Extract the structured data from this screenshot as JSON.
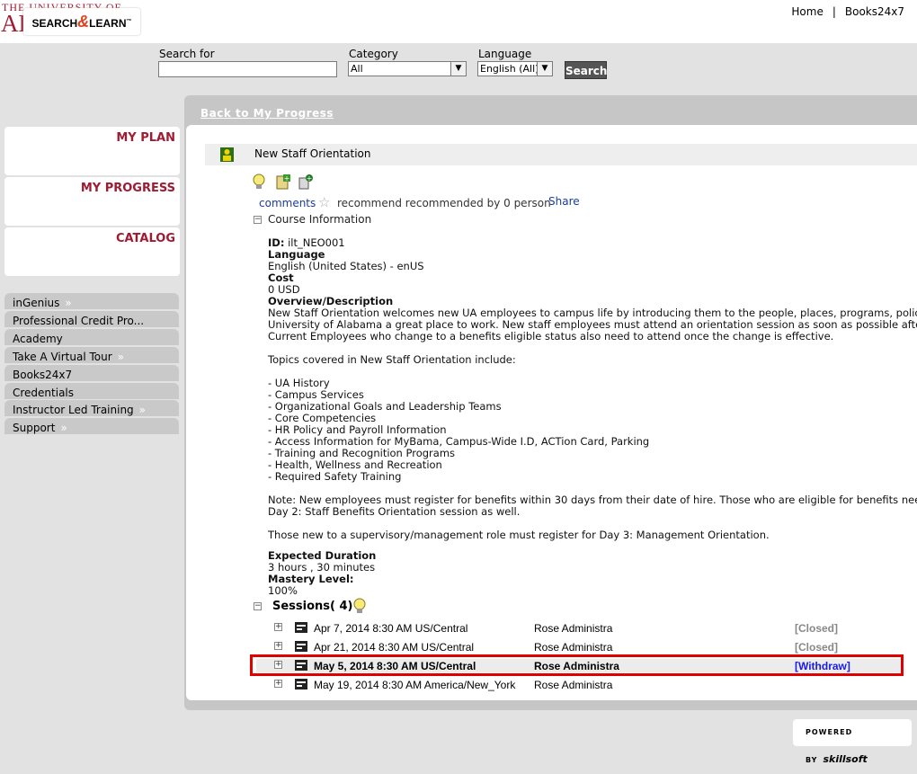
{
  "header": {
    "university_small": "THE UNIVERSITY OF",
    "university_big": "ALABAMA",
    "links": [
      "Home",
      "Books24x7"
    ]
  },
  "search": {
    "logo_left": "SEARCH",
    "logo_amp": "&",
    "logo_right": "LEARN",
    "search_label": "Search for",
    "search_value": "",
    "category_label": "Category",
    "category_value": "All",
    "language_label": "Language",
    "language_value": "English (All)",
    "button": "Search"
  },
  "nav": {
    "big": [
      "MY PLAN",
      "MY PROGRESS",
      "CATALOG"
    ],
    "small": [
      {
        "label": "inGenius",
        "chev": "»"
      },
      {
        "label": "Professional Credit Pro...",
        "chev": ""
      },
      {
        "label": "Academy",
        "chev": ""
      },
      {
        "label": "Take A Virtual Tour",
        "chev": "»"
      },
      {
        "label": "Books24x7",
        "chev": ""
      },
      {
        "label": "Credentials",
        "chev": ""
      },
      {
        "label": "Instructor Led Training",
        "chev": "»"
      },
      {
        "label": "Support",
        "chev": "»"
      }
    ]
  },
  "back_link": "Back to My Progress",
  "course": {
    "title": "New Staff Orientation",
    "comments": "comments",
    "recommend": "recommend recommended by 0 person",
    "share": "Share",
    "info_label": "Course Information",
    "id_label": "ID:",
    "id_value": "ilt_NEO001",
    "language_label": "Language",
    "language_value": "English (United States) - enUS",
    "cost_label": "Cost",
    "cost_value": "0 USD",
    "overview_label": "Overview/Description",
    "overview_lines": [
      "New Staff Orientation welcomes new UA employees to campus life by introducing them to the people, places, programs, policies",
      "University of Alabama a great place to work. New staff employees must attend an orientation session as soon as possible after",
      "Current Employees who change to a benefits eligible status also need to attend once the change is effective."
    ],
    "topics_intro": "Topics covered in New Staff Orientation include:",
    "topics": [
      "- UA History",
      "- Campus Services",
      "- Organizational Goals and Leadership Teams",
      "- Core Competencies",
      "- HR Policy and Payroll Information",
      "- Access Information for MyBama, Campus-Wide I.D, ACTion Card, Parking",
      "- Training and Recognition Programs",
      "- Health, Wellness and Recreation",
      "- Required Safety Training"
    ],
    "note_lines": [
      "Note: New employees must register for benefits within 30 days from their date of hire. Those who are eligible for benefits need",
      "Day 2: Staff Benefits Orientation session as well."
    ],
    "supervisor_note": "Those new to a supervisory/management role must register for Day 3: Management Orientation.",
    "duration_label": "Expected Duration",
    "duration_value": "3 hours , 30 minutes",
    "mastery_label": "Mastery Level:",
    "mastery_value": "100%",
    "sessions_label": "Sessions( 4)"
  },
  "sessions": [
    {
      "date": "Apr 7, 2014 8:30 AM US/Central",
      "instructor": "Rose Administra",
      "status": "[Closed]"
    },
    {
      "date": "Apr 21, 2014 8:30 AM US/Central",
      "instructor": "Rose Administra",
      "status": "[Closed]"
    },
    {
      "date": "May 5, 2014 8:30 AM US/Central",
      "instructor": "Rose Administra",
      "status": "[Withdraw]"
    },
    {
      "date": "May 19, 2014 8:30 AM America/New_York",
      "instructor": "Rose Administra",
      "status": ""
    }
  ],
  "footer": {
    "powered": "POWERED BY",
    "brand": "skillsoft"
  },
  "colors": {
    "brand": "#9e1b32",
    "link": "#1a3c9c",
    "highlight": "#e00000"
  }
}
